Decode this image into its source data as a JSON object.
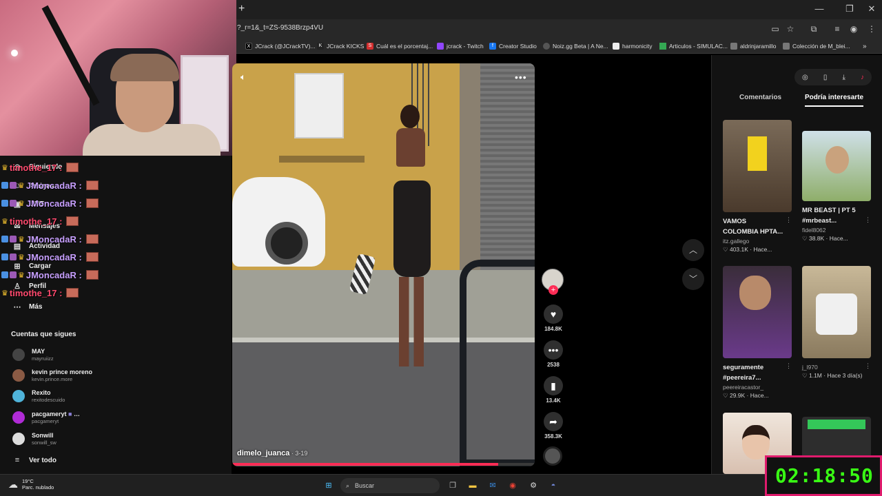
{
  "browser": {
    "url": "?_r=1&_t=ZS-9538Brzp4VU",
    "new_tab": "+",
    "bookmarks": [
      {
        "label": "JCrack (@JCrackTV)...",
        "icon": "x-icon",
        "color": "#000000"
      },
      {
        "label": "JCrack KICKS",
        "icon": "kick-icon",
        "color": "#222222"
      },
      {
        "label": "Cuál es el porcentaj...",
        "icon": "s-icon",
        "color": "#d32f2f"
      },
      {
        "label": "jcrack - Twitch",
        "icon": "twitch-icon",
        "color": "#9146ff"
      },
      {
        "label": "Creator Studio",
        "icon": "facebook-icon",
        "color": "#1877f2"
      },
      {
        "label": "Noiz.gg Beta | A Ne...",
        "icon": "noiz-icon",
        "color": "#555555"
      },
      {
        "label": "harmonicity",
        "icon": "harmonicity-icon",
        "color": "#eeeeee"
      },
      {
        "label": "Articulos - SIMULAC...",
        "icon": "drive-icon",
        "color": "#34a853"
      },
      {
        "label": "aldrinjaramillo",
        "icon": "aldrin-icon",
        "color": "#777777"
      },
      {
        "label": "Colección de M_blei...",
        "icon": "coleccion-icon",
        "color": "#777777"
      }
    ]
  },
  "chat": [
    {
      "name": "timothe_17 :",
      "color": "#ff4a6e"
    },
    {
      "name": "JMoncadaR :",
      "color": "#c8a0ff"
    },
    {
      "name": "JMoncadaR :",
      "color": "#c8a0ff"
    },
    {
      "name": "timothe_17 :",
      "color": "#ff4a6e"
    },
    {
      "name": "JMoncadaR :",
      "color": "#c8a0ff"
    },
    {
      "name": "JMoncadaR :",
      "color": "#c8a0ff"
    },
    {
      "name": "JMoncadaR :",
      "color": "#c8a0ff"
    },
    {
      "name": "timothe_17 :",
      "color": "#ff4a6e"
    }
  ],
  "sidebar": {
    "nav": [
      {
        "label": "Siguiendo",
        "icon": "following-icon"
      },
      {
        "label": "Amigos",
        "icon": "friends-icon"
      },
      {
        "label": "LIVE",
        "icon": "live-icon"
      },
      {
        "label": "Mensajes",
        "icon": "messages-icon"
      },
      {
        "label": "Actividad",
        "icon": "activity-icon"
      },
      {
        "label": "Cargar",
        "icon": "upload-icon"
      },
      {
        "label": "Perfil",
        "icon": "profile-icon"
      },
      {
        "label": "Más",
        "icon": "more-icon"
      }
    ],
    "following_title": "Cuentas que sigues",
    "accounts": [
      {
        "name": "MAY",
        "handle": "mayruiizz",
        "color": "#444444"
      },
      {
        "name": "kevin prince moreno",
        "handle": "kevin.prince.more",
        "color": "#8a5a44"
      },
      {
        "name": "Rexito",
        "handle": "rexitodescuido",
        "color": "#4fb3d9"
      },
      {
        "name": "pacgameryt",
        "handle": "pacgameryt",
        "color": "#b02bd6"
      },
      {
        "name": "Sonwill",
        "handle": "sonwill_sw",
        "color": "#dddddd"
      }
    ],
    "see_all": "Ver todo"
  },
  "video": {
    "author": "dimelo_juanca",
    "date": "3-19",
    "progress": 0.88
  },
  "actions": {
    "likes": "184.8K",
    "comments": "2538",
    "saves": "13.4K",
    "shares": "358.3K"
  },
  "right_panel": {
    "tab_comments": "Comentarios",
    "tab_interest": "Podría interesarte",
    "cards": [
      {
        "title1": "VAMOS",
        "title2": "COLOMBIA HPTA...",
        "author": "itz.gallego",
        "meta": "♡ 403.1K · Hace...",
        "color": "#6a5a48"
      },
      {
        "title1": "MR BEAST | PT 5",
        "title2": "#mrbeast...",
        "author": "fidel8062",
        "meta": "♡ 38.8K · Hace...",
        "color": "#8fae6a"
      },
      {
        "title1": "seguramente",
        "title2": "#peereira7...",
        "author": "peereiracastor_",
        "meta": "♡ 29.9K · Hace...",
        "color": "#3a2d3a"
      },
      {
        "title1": "",
        "title2": "",
        "author": "j_l970",
        "meta": "♡ 1.1M · Hace 3 día(s)",
        "color": "#b8a890"
      },
      {
        "title1": "",
        "title2": "",
        "author": "",
        "meta": "",
        "color": "#e8dcd2"
      },
      {
        "title1": "",
        "title2": "",
        "author": "",
        "meta": "",
        "color": "#2d2d2d"
      }
    ]
  },
  "taskbar": {
    "temp": "19°C",
    "weather": "Parc. nublado",
    "search": "Buscar"
  },
  "timer": "02:18:50"
}
